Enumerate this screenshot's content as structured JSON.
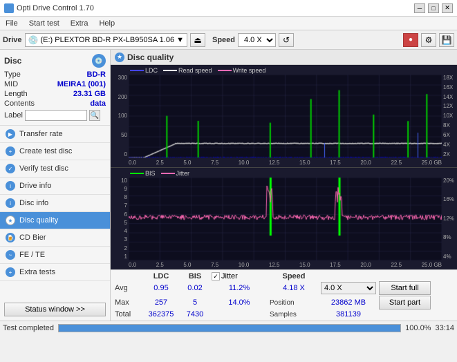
{
  "titleBar": {
    "title": "Opti Drive Control 1.70",
    "icon": "ODC",
    "controls": [
      "─",
      "□",
      "✕"
    ]
  },
  "menuBar": {
    "items": [
      "File",
      "Start test",
      "Extra",
      "Help"
    ]
  },
  "toolbar": {
    "driveLabel": "Drive",
    "driveValue": "(E:)  PLEXTOR BD-R  PX-LB950SA 1.06",
    "speedLabel": "Speed",
    "speedValue": "4.0 X",
    "ejectIcon": "⏏",
    "refreshIcon": "↺",
    "burnIcon": "●",
    "infoIcon": "ℹ",
    "saveIcon": "💾"
  },
  "disc": {
    "title": "Disc",
    "typeLabel": "Type",
    "typeValue": "BD-R",
    "midLabel": "MID",
    "midValue": "MEIRA1 (001)",
    "lengthLabel": "Length",
    "lengthValue": "23.31 GB",
    "contentsLabel": "Contents",
    "contentsValue": "data",
    "labelLabel": "Label",
    "labelValue": ""
  },
  "nav": {
    "items": [
      {
        "id": "transfer-rate",
        "label": "Transfer rate",
        "active": false
      },
      {
        "id": "create-test-disc",
        "label": "Create test disc",
        "active": false
      },
      {
        "id": "verify-test-disc",
        "label": "Verify test disc",
        "active": false
      },
      {
        "id": "drive-info",
        "label": "Drive info",
        "active": false
      },
      {
        "id": "disc-info",
        "label": "Disc info",
        "active": false
      },
      {
        "id": "disc-quality",
        "label": "Disc quality",
        "active": true
      },
      {
        "id": "cd-bier",
        "label": "CD Bier",
        "active": false
      },
      {
        "id": "fe-te",
        "label": "FE / TE",
        "active": false
      },
      {
        "id": "extra-tests",
        "label": "Extra tests",
        "active": false
      }
    ],
    "statusBtn": "Status window >>"
  },
  "discQuality": {
    "title": "Disc quality",
    "chart1": {
      "legend": [
        {
          "label": "LDC",
          "color": "#0000ff"
        },
        {
          "label": "Read speed",
          "color": "#ffffff"
        },
        {
          "label": "Write speed",
          "color": "#ff69b4"
        }
      ],
      "yAxisLeft": [
        "300",
        "200",
        "100",
        "50",
        "0"
      ],
      "yAxisRight": [
        "18X",
        "16X",
        "14X",
        "12X",
        "10X",
        "8X",
        "6X",
        "4X",
        "2X"
      ],
      "xAxis": [
        "0.0",
        "2.5",
        "5.0",
        "7.5",
        "10.0",
        "12.5",
        "15.0",
        "17.5",
        "20.0",
        "22.5",
        "25.0 GB"
      ]
    },
    "chart2": {
      "legend": [
        {
          "label": "BIS",
          "color": "#00ff00"
        },
        {
          "label": "Jitter",
          "color": "#ff69b4"
        }
      ],
      "yAxisLeft": [
        "10",
        "9",
        "8",
        "7",
        "6",
        "5",
        "4",
        "3",
        "2",
        "1"
      ],
      "yAxisRight": [
        "20%",
        "16%",
        "12%",
        "8%",
        "4%"
      ],
      "xAxis": [
        "0.0",
        "2.5",
        "5.0",
        "7.5",
        "10.0",
        "12.5",
        "15.0",
        "17.5",
        "20.0",
        "22.5",
        "25.0 GB"
      ]
    }
  },
  "statsPanel": {
    "headers": [
      "",
      "LDC",
      "BIS",
      "",
      "Jitter",
      "Speed",
      ""
    ],
    "jitterChecked": true,
    "rows": [
      {
        "label": "Avg",
        "ldc": "0.95",
        "bis": "0.02",
        "jitter": "11.2%",
        "speed": "4.18 X"
      },
      {
        "label": "Max",
        "ldc": "257",
        "bis": "5",
        "jitter": "14.0%",
        "position": "23862 MB"
      },
      {
        "label": "Total",
        "ldc": "362375",
        "bis": "7430",
        "samples": "381139"
      }
    ],
    "speedSelect": "4.0 X",
    "startFullBtn": "Start full",
    "startPartBtn": "Start part"
  },
  "bottomBar": {
    "statusText": "Test completed",
    "progress": 100,
    "progressText": "100.0%",
    "timeText": "33:14"
  }
}
